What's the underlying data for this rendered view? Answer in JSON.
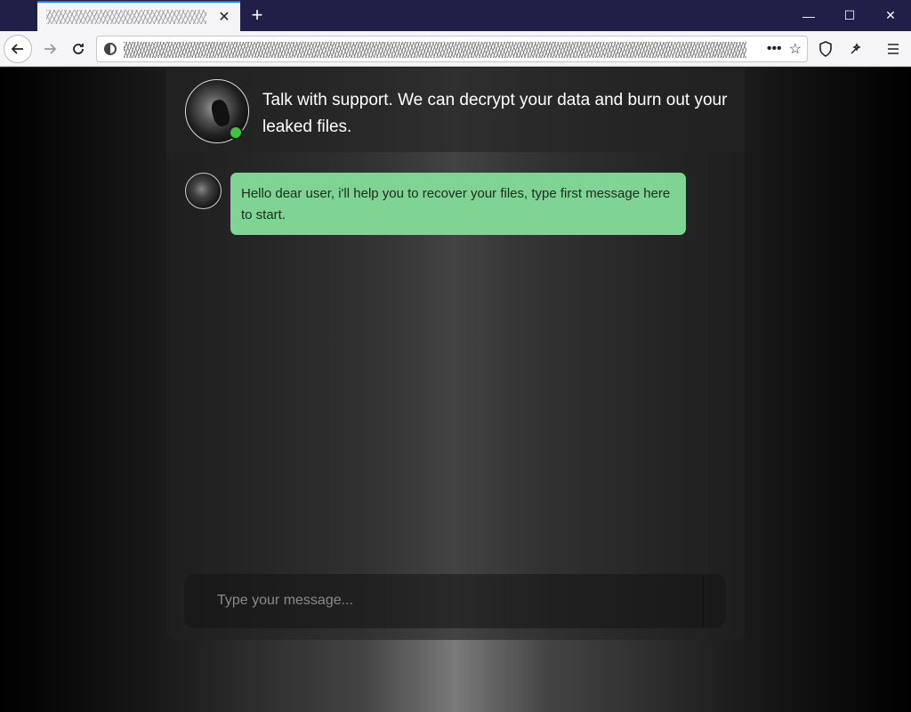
{
  "browser": {
    "tab_close": "✕",
    "new_tab": "+",
    "window_controls": {
      "minimize": "—",
      "maximize": "☐",
      "close": "✕"
    },
    "toolbar_icons": [
      "back-arrow-icon",
      "forward-arrow-icon",
      "reload-icon",
      "more-icon",
      "bookmark-star-icon",
      "shield-icon",
      "extension-icon",
      "menu-icon"
    ]
  },
  "chat": {
    "header_title": "Talk with support. We can decrypt your data and burn out your leaked files.",
    "status": "online",
    "status_color": "#3ec43e",
    "messages": [
      {
        "sender": "support",
        "text": "Hello dear user, i'll help you to recover your files, type first message here to start."
      }
    ],
    "bubble_color": "#7fd494",
    "input_placeholder": "Type your message..."
  }
}
